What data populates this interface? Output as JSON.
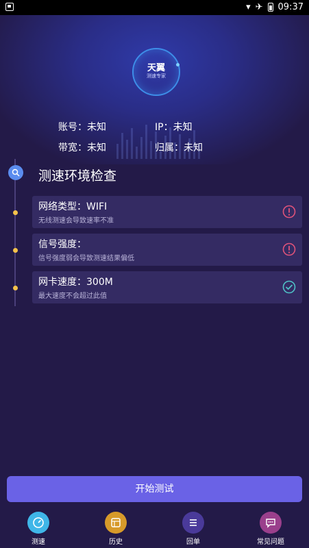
{
  "status_bar": {
    "time": "09:37"
  },
  "logo": {
    "title": "天翼",
    "subtitle": "测速专家"
  },
  "info": [
    {
      "label": "账号：未知"
    },
    {
      "label": "IP：未知"
    },
    {
      "label": "带宽：未知"
    },
    {
      "label": "归属：未知"
    }
  ],
  "section": {
    "title": "测速环境检查"
  },
  "checks": [
    {
      "title": "网络类型：WIFI",
      "desc": "无线测速会导致速率不准",
      "status": "warning",
      "color": "#e0537a"
    },
    {
      "title": "信号强度：",
      "desc": "信号强度弱会导致测速结果偏低",
      "status": "warning",
      "color": "#e0537a"
    },
    {
      "title": "网卡速度：300M",
      "desc": "最大速度不会超过此值",
      "status": "ok",
      "color": "#4fc1c6"
    }
  ],
  "start_button": "开始测试",
  "nav": [
    {
      "label": "测速",
      "color": "#3fb6e8",
      "icon": "speed-icon"
    },
    {
      "label": "历史",
      "color": "#d79a2a",
      "icon": "history-icon"
    },
    {
      "label": "回单",
      "color": "#4a3a9a",
      "icon": "receipt-icon"
    },
    {
      "label": "常见问题",
      "color": "#9a3f8c",
      "icon": "faq-icon"
    }
  ]
}
